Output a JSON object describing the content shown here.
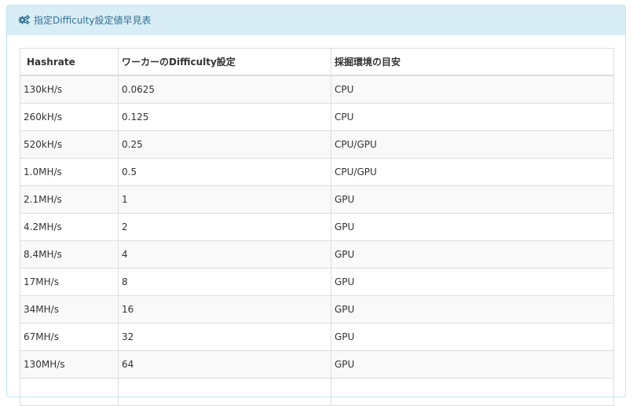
{
  "panel": {
    "title": "指定Difficulty設定値早見表",
    "icon": "gears-icon"
  },
  "table": {
    "headers": [
      "Hashrate",
      "ワーカーのDifficulty設定",
      "採掘環境の目安"
    ],
    "rows": [
      [
        "130kH/s",
        "0.0625",
        "CPU"
      ],
      [
        "260kH/s",
        "0.125",
        "CPU"
      ],
      [
        "520kH/s",
        "0.25",
        "CPU/GPU"
      ],
      [
        "1.0MH/s",
        "0.5",
        "CPU/GPU"
      ],
      [
        "2.1MH/s",
        "1",
        "GPU"
      ],
      [
        "4.2MH/s",
        "2",
        "GPU"
      ],
      [
        "8.4MH/s",
        "4",
        "GPU"
      ],
      [
        "17MH/s",
        "8",
        "GPU"
      ],
      [
        "34MH/s",
        "16",
        "GPU"
      ],
      [
        "67MH/s",
        "32",
        "GPU"
      ],
      [
        "130MH/s",
        "64",
        "GPU"
      ],
      [
        "",
        "",
        ""
      ]
    ]
  },
  "colors": {
    "heading_bg": "#d9edf7",
    "heading_text": "#31708f",
    "border": "#bce8f1",
    "stripe": "#f9f9f9"
  }
}
